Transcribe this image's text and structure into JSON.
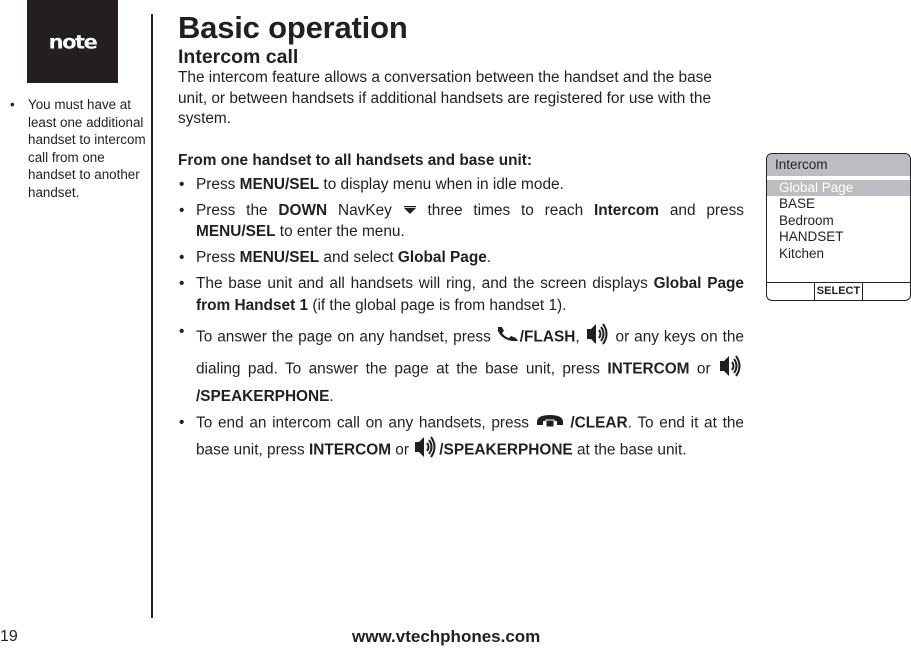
{
  "sidebar": {
    "note_label": "note",
    "note_text": "You must have at least one additional handset to intercom call from one handset to another handset."
  },
  "header": {
    "title": "Basic operation",
    "section": "Intercom call"
  },
  "intro": "The intercom feature allows a conversation between the handset and the base unit, or between handsets if additional handsets are registered for use with the system.",
  "procedure": {
    "heading": "From one handset to all handsets and base unit:",
    "steps": [
      {
        "t1": "Press ",
        "b1": "MENU/SEL",
        "t2": " to display menu when in idle mode."
      },
      {
        "t1": "Press the ",
        "b1": "DOWN",
        "t2": " NavKey ",
        "icon": "down-arrow-icon",
        "t3": " three times to reach ",
        "b2": "Intercom",
        "t4": " and press ",
        "b3": "MENU/SEL",
        "t5": " to enter the menu."
      },
      {
        "t1": "Press ",
        "b1": "MENU/SEL",
        "t2": " and select ",
        "b2": "Global Page",
        "t3": "."
      },
      {
        "t1": "The base unit and all handsets will ring, and the screen displays ",
        "b1": "Global Page from Handset 1",
        "t2": " (if the global page is from handset 1)."
      },
      {
        "t1": "To answer the page on any handset, press ",
        "icon1": "phone-talk-icon",
        "b1": "/FLASH",
        "t2": ", ",
        "icon2": "speaker-icon",
        "t3": " or any  keys on the dialing pad. To answer the page at the base unit, press ",
        "b2": "INTERCOM",
        "t4": " or ",
        "icon3": "speaker-icon",
        "b3": " /SPEAKERPHONE",
        "t5": "."
      },
      {
        "t1": "To end an intercom call on any handsets, press ",
        "icon1": "phone-off-icon",
        "b1": " /CLEAR",
        "t2": ". To end it at the base unit, press ",
        "b2": "INTERCOM",
        "t3": " or ",
        "icon2": "speaker-icon",
        "b3": "/SPEAKERPHONE",
        "t4": " at the base unit."
      }
    ]
  },
  "screen": {
    "title": "Intercom",
    "items": [
      "Global Page",
      "BASE",
      "Bedroom",
      "HANDSET",
      "Kitchen"
    ],
    "selected_index": 0,
    "softkey": "SELECT"
  },
  "footer": {
    "page_number": "19",
    "url": "www.vtechphones.com"
  }
}
